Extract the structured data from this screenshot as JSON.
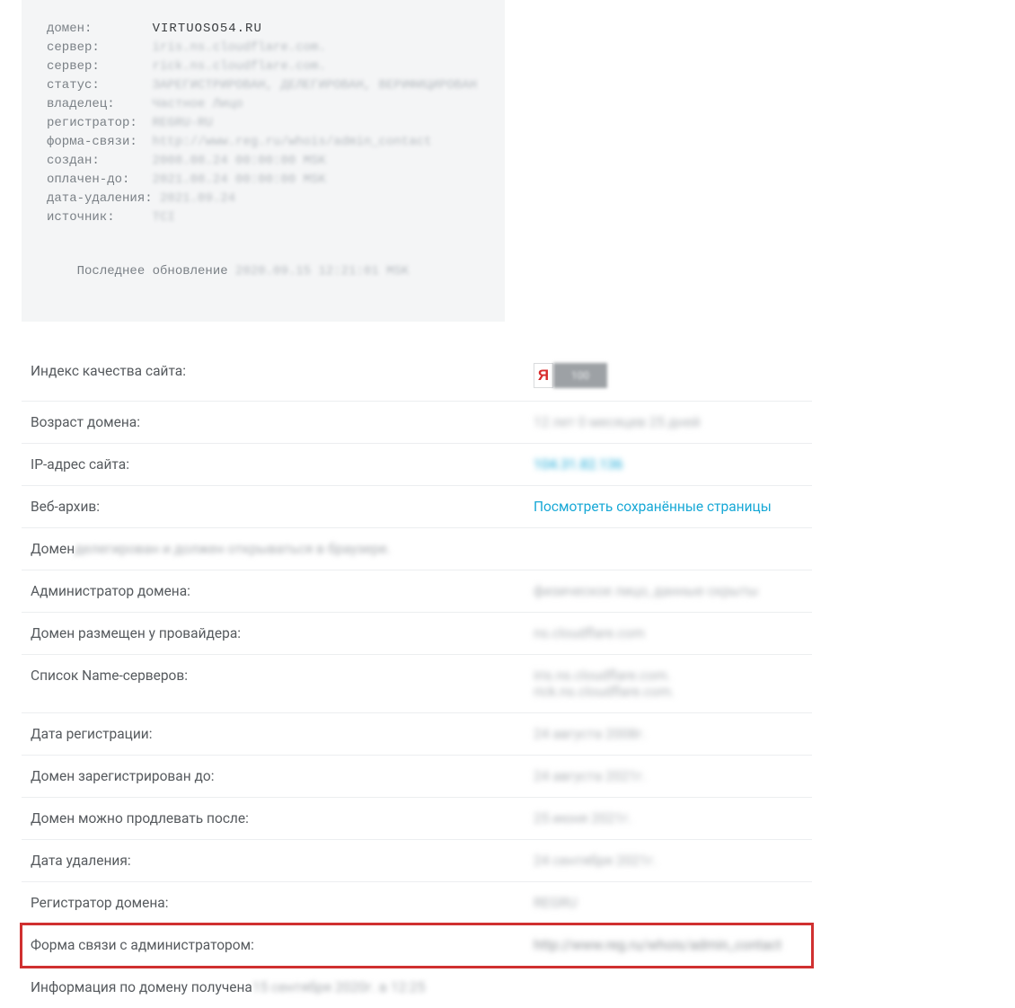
{
  "whois": {
    "rows": [
      {
        "key": "домен:",
        "pad": "        ",
        "value": "VIRTUOSO54.RU",
        "clear": true
      },
      {
        "key": "сервер:",
        "pad": "       ",
        "value": "iris.ns.cloudflare.com.",
        "clear": false
      },
      {
        "key": "сервер:",
        "pad": "       ",
        "value": "rick.ns.cloudflare.com.",
        "clear": false
      },
      {
        "key": "статус:",
        "pad": "       ",
        "value": "ЗАРЕГИСТРИРОВАН, ДЕЛЕГИРОВАН, ВЕРИФИЦИРОВАН",
        "clear": false
      },
      {
        "key": "владелец:",
        "pad": "     ",
        "value": "Частное Лицо",
        "clear": false
      },
      {
        "key": "регистратор:",
        "pad": "  ",
        "value": "REGRU-RU",
        "clear": false
      },
      {
        "key": "форма-связи:",
        "pad": "  ",
        "value": "http://www.reg.ru/whois/admin_contact",
        "clear": false
      },
      {
        "key": "создан:",
        "pad": "       ",
        "value": "2008.08.24 00:00:00 MSK",
        "clear": false
      },
      {
        "key": "оплачен-до:",
        "pad": "   ",
        "value": "2021.08.24 00:00:00 MSK",
        "clear": false
      },
      {
        "key": "дата-удаления:",
        "pad": " ",
        "value": "2021.09.24",
        "clear": false
      },
      {
        "key": "источник:",
        "pad": "     ",
        "value": "TCI",
        "clear": false
      }
    ],
    "update_prefix": "Последнее обновление ",
    "update_value": "2020.09.15 12:21:01 MSK"
  },
  "info": {
    "quality_label": "Индекс качества сайта:",
    "quality_logo": "Я",
    "quality_value": "100",
    "age_label": "Возраст домена:",
    "age_value": "12 лет 0 месяцев 25 дней",
    "ip_label": "IP-адрес сайта:",
    "ip_value": "104.31.82.136",
    "archive_label": "Веб-архив:",
    "archive_value": "Посмотреть сохранённые страницы",
    "domain_status_label": "Домен ",
    "domain_status_value": "делегирован и должен открываться в браузере.",
    "admin_label": "Администратор домена:",
    "admin_value": "физическое лицо, данные скрыты",
    "provider_label": "Домен размещен у провайдера:",
    "provider_value": "ns.cloudflare.com",
    "ns_label": "Список Name-серверов:",
    "ns_value1": "iris.ns.cloudflare.com.",
    "ns_value2": "rick.ns.cloudflare.com.",
    "regdate_label": "Дата регистрации:",
    "regdate_value": "24 августа 2008г.",
    "until_label": "Домен зарегистрирован до:",
    "until_value": "24 августа 2021г.",
    "renew_label": "Домен можно продлевать после:",
    "renew_value": "25 июня 2021г.",
    "delete_label": "Дата удаления:",
    "delete_value": "24 сентября 2021г.",
    "registrar_label": "Регистратор домена:",
    "registrar_value": "REGRU",
    "contact_label": "Форма связи с администратором:",
    "contact_value": "http://www.reg.ru/whois/admin_contact",
    "received_prefix": "Информация по домену получена ",
    "received_value": "15 сентября 2020г. в 12:25"
  }
}
